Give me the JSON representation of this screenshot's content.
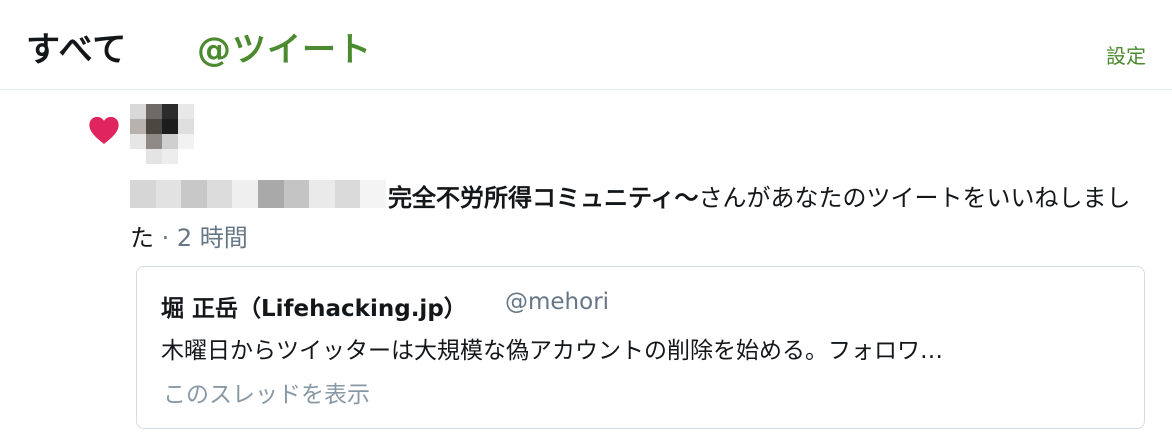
{
  "header": {
    "tab_all": "すべて",
    "tab_mentions": "@ツイート",
    "settings": "設定"
  },
  "notification": {
    "icon": "heart-icon",
    "icon_color": "#e0245e",
    "actor": "完全不労所得コミュニティ〜",
    "action": "さんがあなたのツイートをいいねしました",
    "separator": " · ",
    "time": "2 時間"
  },
  "tweet": {
    "author": "堀 正岳（Lifehacking.jp）",
    "handle": "@mehori",
    "text": "木曜日からツイッターは大規模な偽アカウントの削除を始める。フォロワ…",
    "thread_link": "このスレッドを表示"
  },
  "colors": {
    "accent": "#4b8a2e",
    "muted": "#657786",
    "border": "#e6ecf0"
  }
}
